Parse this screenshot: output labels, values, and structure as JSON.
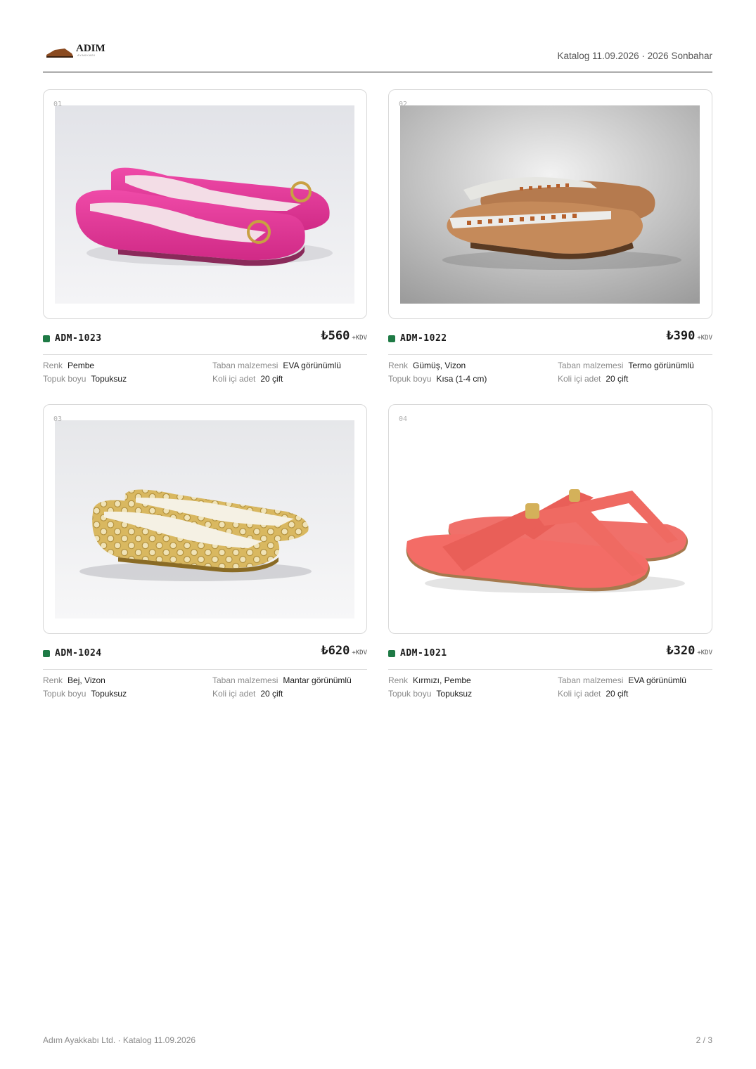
{
  "brand": {
    "name": "ADIM",
    "tagline": "AYAKKABI"
  },
  "header": {
    "catalog_label": "Katalog 11.09.2026",
    "separator": "·",
    "season": "2026 Sonbahar"
  },
  "spec_labels": {
    "color": "Renk",
    "sole": "Taban malzemesi",
    "heel": "Topuk boyu",
    "pack": "Koli içi adet"
  },
  "vat_label": "+KDV",
  "products": [
    {
      "index": "01",
      "sku": "ADM-1023",
      "price": "₺560",
      "color": "Pembe",
      "sole": "EVA görünümlü",
      "heel": "Topuksuz",
      "pack": "20 çift",
      "photo_icon": "pink-ballet-flat-photo"
    },
    {
      "index": "02",
      "sku": "ADM-1022",
      "price": "₺390",
      "color": "Gümüş, Vizon",
      "sole": "Termo görünümlü",
      "heel": "Kısa (1-4 cm)",
      "pack": "20 çift",
      "photo_icon": "studded-flip-flop-photo"
    },
    {
      "index": "03",
      "sku": "ADM-1024",
      "price": "₺620",
      "color": "Bej, Vizon",
      "sole": "Mantar görünümlü",
      "heel": "Topuksuz",
      "pack": "20 çift",
      "photo_icon": "gold-perforated-flat-photo"
    },
    {
      "index": "04",
      "sku": "ADM-1021",
      "price": "₺320",
      "color": "Kırmızı, Pembe",
      "sole": "EVA görünümlü",
      "heel": "Topuksuz",
      "pack": "20 çift",
      "photo_icon": "coral-thong-sandal-photo"
    }
  ],
  "footer": {
    "company": "Adım Ayakkabı Ltd. · Katalog 11.09.2026",
    "page": "2 / 3"
  }
}
